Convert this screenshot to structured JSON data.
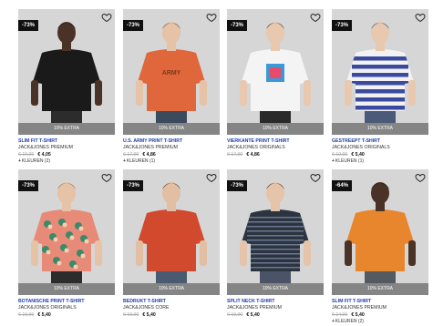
{
  "products": [
    {
      "name": "SLIM FIT T-SHIRT",
      "brand": "JACK&JONES PREMIUM",
      "badge": "-73%",
      "extra": "10% EXTRA",
      "old_price": "€ 19,99",
      "price": "€ 4,05",
      "colors": "KLEUREN (2)",
      "skin": "#4a3226",
      "hair": "#1a1210",
      "shirt": "#1a1a1a",
      "pants": "#2c2c2c",
      "pattern": "solid"
    },
    {
      "name": "U.S. ARMY PRINT T-SHIRT",
      "brand": "JACK&JONES PREMIUM",
      "badge": "-73%",
      "extra": "10% EXTRA",
      "old_price": "€ 17,99",
      "price": "€ 4,86",
      "colors": "KLEUREN (1)",
      "skin": "#e6c2a6",
      "hair": "#6b4a33",
      "shirt": "#e0673b",
      "pants": "#3c4a5e",
      "pattern": "print"
    },
    {
      "name": "VIERKANTE PRINT T-SHIRT",
      "brand": "JACK&JONES ORIGINALS",
      "badge": "-73%",
      "extra": "10% EXTRA",
      "old_price": "€ 17,99",
      "price": "€ 4,86",
      "colors": "",
      "skin": "#e8c8ae",
      "hair": "#3a2a1e",
      "shirt": "#f4f4f4",
      "pants": "#2a2a2a",
      "pattern": "square"
    },
    {
      "name": "GESTREEPT T-SHIRT",
      "brand": "JACK&JONES ORIGINALS",
      "badge": "-73%",
      "extra": "10% EXTRA",
      "old_price": "€ 19,99",
      "price": "€ 5,40",
      "colors": "KLEUREN (1)",
      "skin": "#e8c8ae",
      "hair": "#2a3a8a",
      "shirt": "#f2f2f2",
      "pants": "#4a5a78",
      "pattern": "stripes-blue"
    },
    {
      "name": "BOTANISCHE PRINT T-SHIRT",
      "brand": "JACK&JONES ORIGINALS",
      "badge": "-73%",
      "extra": "10% EXTRA",
      "old_price": "€ 19,99",
      "price": "€ 5,40",
      "colors": "",
      "skin": "#e6c2a6",
      "hair": "#8a6a44",
      "shirt": "#e88a78",
      "pants": "#2c2c2c",
      "pattern": "floral"
    },
    {
      "name": "BEDRUKT T-SHIRT",
      "brand": "JACK&JONES CORE",
      "badge": "-73%",
      "extra": "10% EXTRA",
      "old_price": "€ 19,99",
      "price": "€ 5,40",
      "colors": "",
      "skin": "#e2bea2",
      "hair": "#4a3a2a",
      "shirt": "#d14a2e",
      "pants": "#4a5a70",
      "pattern": "solid"
    },
    {
      "name": "SPLIT NECK T-SHIRT",
      "brand": "JACK&JONES PREMIUM",
      "badge": "-73%",
      "extra": "10% EXTRA",
      "old_price": "€ 19,99",
      "price": "€ 5,40",
      "colors": "",
      "skin": "#e6c4aa",
      "hair": "#3a2a1e",
      "shirt": "#2c3440",
      "pants": "#4a5466",
      "pattern": "stripes-dark"
    },
    {
      "name": "SLIM FIT T-SHIRT",
      "brand": "JACK&JONES PREMIUM",
      "badge": "-64%",
      "extra": "10% EXTRA",
      "old_price": "€ 14,99",
      "price": "€ 5,40",
      "colors": "KLEUREN (2)",
      "skin": "#4a3226",
      "hair": "#1a1210",
      "shirt": "#e8862e",
      "pants": "#555a60",
      "pattern": "solid"
    }
  ]
}
